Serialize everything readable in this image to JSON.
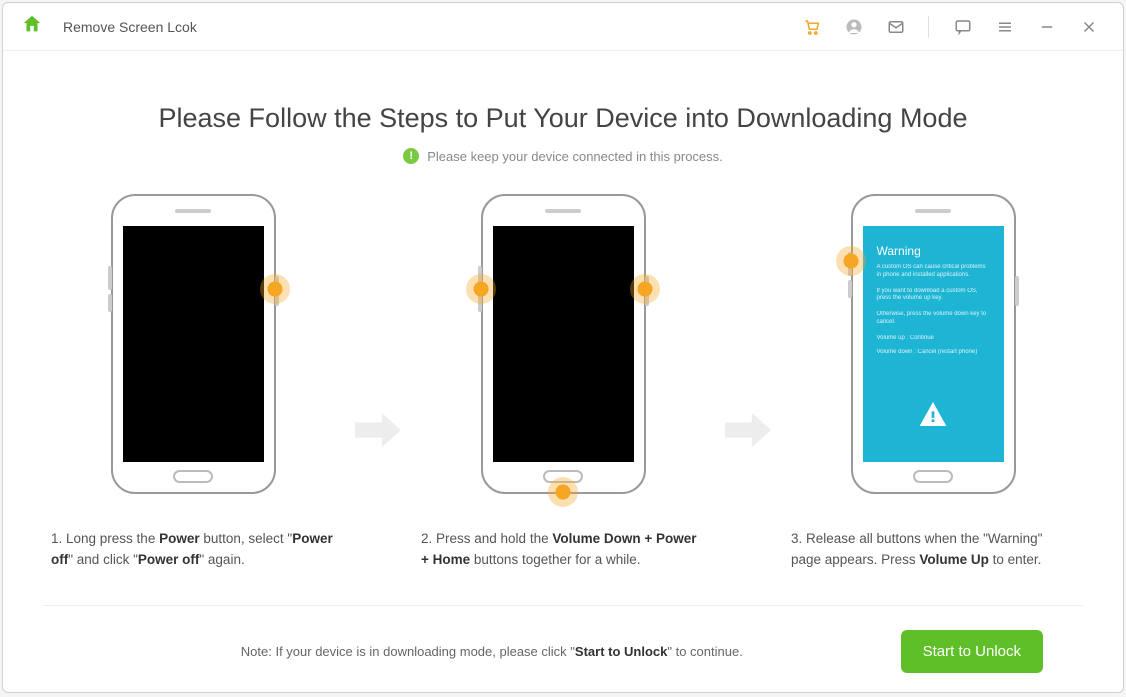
{
  "titlebar": {
    "title": "Remove Screen Lcok"
  },
  "heading": "Please Follow the Steps to Put Your Device into Downloading Mode",
  "subheading": "Please keep your device connected in this process.",
  "steps": {
    "s1_prefix": "1. Long press the ",
    "s1_b1": "Power",
    "s1_mid1": " button, select \"",
    "s1_b2": "Power off",
    "s1_mid2": "\" and click \"",
    "s1_b3": "Power off",
    "s1_suffix": "\" again.",
    "s2_prefix": "2. Press and hold the ",
    "s2_b1": "Volume Down + Power + Home",
    "s2_suffix": " buttons together for a while.",
    "s3_prefix": "3. Release all buttons when the \"Warning\" page appears. Press ",
    "s3_b1": "Volume Up",
    "s3_suffix": " to enter."
  },
  "warning_screen": {
    "title": "Warning",
    "line1": "A custom OS can cause critical problems in phone and installed applications.",
    "line2": "If you want to download a custom OS, press the volume up key.",
    "line3": "Otherwise, press the volume down key to cancel.",
    "opt1": "Volume up : Continue",
    "opt2": "Volume down : Cancel (restart phone)"
  },
  "footer": {
    "note_prefix": "Note: If your device is in downloading mode, please click \"",
    "note_b": "Start to Unlock",
    "note_suffix": "\" to continue.",
    "button": "Start to Unlock"
  }
}
